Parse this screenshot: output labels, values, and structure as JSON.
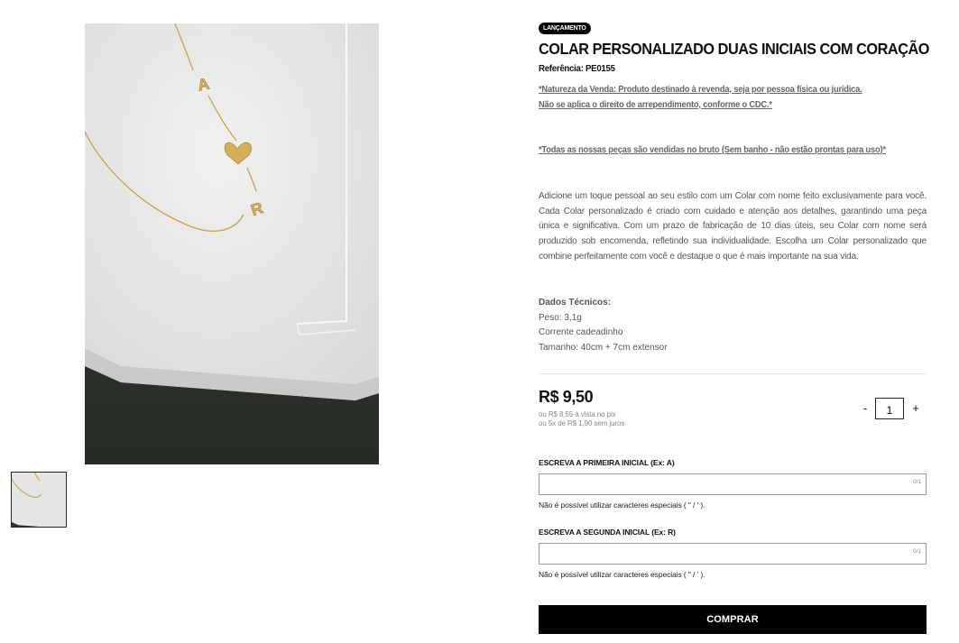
{
  "gallery": {
    "main_alt": "Colar personalizado duas iniciais com coração",
    "pendant_letters": [
      "A",
      "R"
    ]
  },
  "product": {
    "badge": "LANÇAMENTO",
    "title": "COLAR PERSONALIZADO DUAS INICIAIS COM CORAÇÃO",
    "reference": "Referência: PE0155",
    "notice_line1": "*Natureza da Venda: Produto destinado à revenda, seja por pessoa física ou jurídica.",
    "notice_line2": "Não se aplica o direito de arrependimento, conforme o CDC.*",
    "notice_raw": "*Todas as nossas peças são vendidas no bruto (Sem banho - não estão prontas para uso)*",
    "description": "Adicione um toque pessoal ao seu estilo com um Colar com nome feito exclusivamente para você. Cada Colar personalizado é criado com cuidado e atenção aos detalhes, garantindo uma peça única e significativa. Com um prazo de fabricação de 10 dias úteis, seu Colar com nome será produzido sob encomenda, refletindo sua individualidade. Escolha um Colar personalizado que combine perfeitamente com você e destaque o que é mais importante na sua vida.",
    "specs": {
      "title": "Dados Técnicos:",
      "weight": "Peso: 3,1g",
      "chain": "Corrente cadeadinho",
      "size": "Tamanho: 40cm + 7cm extensor"
    }
  },
  "pricing": {
    "price": "R$ 9,50",
    "pix": "ou R$ 8,55 à vista no pix",
    "installments": "ou 5x de R$ 1,90 sem juros"
  },
  "quantity": {
    "minus": "-",
    "value": "1",
    "plus": "+"
  },
  "fields": [
    {
      "label": "ESCREVA A PRIMEIRA INICIAL (Ex: A)",
      "value": "",
      "counter": "0/1",
      "hint": "Não é possível utilizar caracteres especiais ( \" / ' )."
    },
    {
      "label": "ESCREVA A SEGUNDA INICIAL (Ex: R)",
      "value": "",
      "counter": "0/1",
      "hint": "Não é possível utilizar caracteres especiais ( \" / ' )."
    }
  ],
  "actions": {
    "buy": "COMPRAR"
  },
  "colors": {
    "accent": "#000000",
    "muted_text": "#555555",
    "gold": "#d4b05a",
    "backdrop": "#2f352d",
    "tray": "#e9e9e8"
  }
}
